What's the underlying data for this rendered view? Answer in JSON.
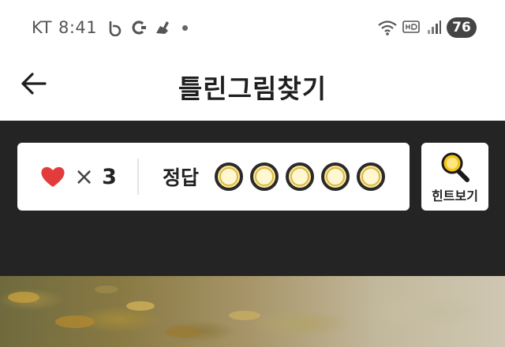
{
  "status_bar": {
    "carrier": "KT",
    "time": "8:41",
    "battery": "76",
    "notification_icons": [
      "band-icon",
      "coupang-icon",
      "running-shoe-icon"
    ],
    "system_icons": [
      "wifi-icon",
      "hd-icon",
      "signal-icon"
    ]
  },
  "header": {
    "title": "틀린그림찾기",
    "back_icon": "arrow-left-icon"
  },
  "score": {
    "lives_icon": "heart-icon",
    "times_symbol": "×",
    "lives_count": "3",
    "answer_label": "정답",
    "answer_slots_total": 5,
    "answers_found": 0
  },
  "hint": {
    "label": "힌트보기",
    "icon": "magnifier-icon"
  },
  "colors": {
    "panel_bg": "#242424",
    "heart": "#e23b3b",
    "slot_fill": "#fde89a",
    "magnifier": "#f5c518"
  }
}
